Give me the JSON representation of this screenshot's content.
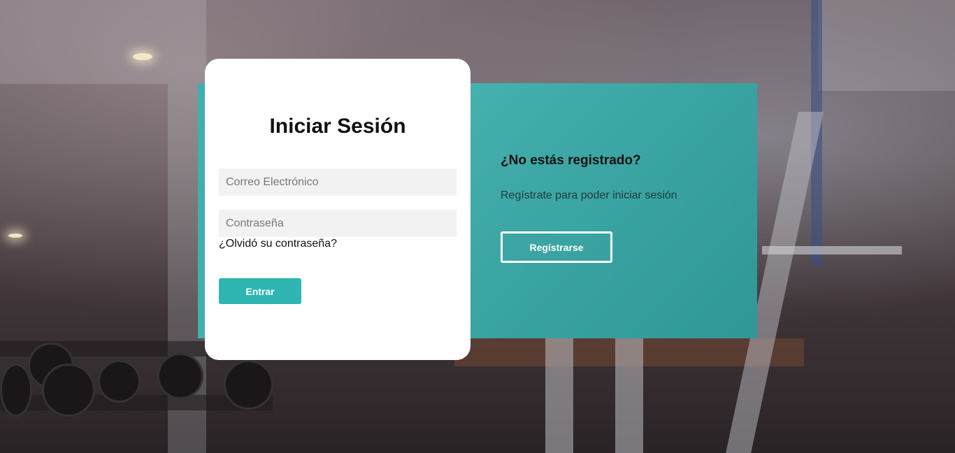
{
  "login": {
    "title": "Iniciar Sesión",
    "email_placeholder": "Correo Electrónico",
    "password_placeholder": "Contraseña",
    "forgot_link": "¿Olvidó su contraseña?",
    "submit_label": "Entrar"
  },
  "register": {
    "title": "¿No estás registrado?",
    "text": "Regístrate para poder iniciar sesión",
    "button_label": "Regístrarse"
  },
  "colors": {
    "accent": "#2fb5b2",
    "panel_teal": "#3fa9a7",
    "card_bg": "#ffffff"
  }
}
